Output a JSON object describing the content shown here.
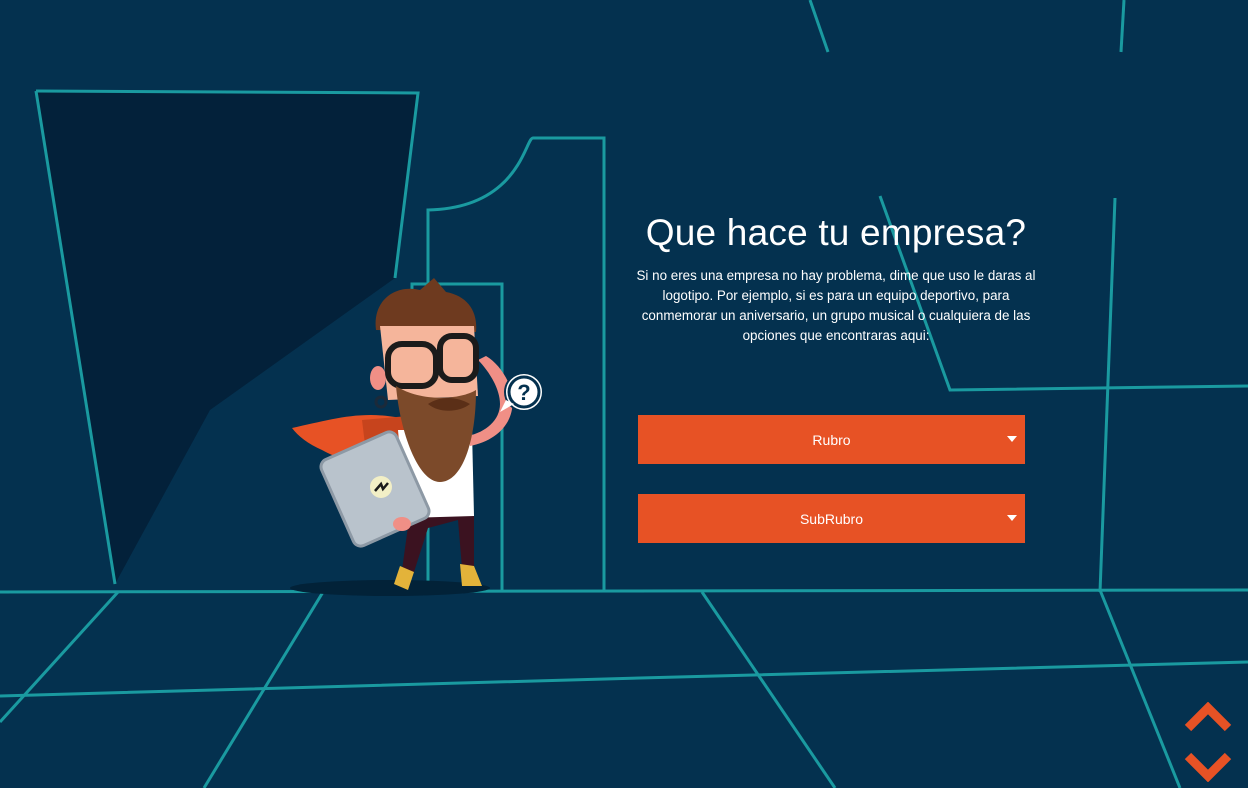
{
  "intro": {
    "title": "Que hace tu empresa?",
    "description": "Si no eres una empresa no hay problema, dime que uso le daras al logotipo. Por ejemplo, si es para un equipo deportivo, para conmemorar un aniversario, un grupo musical o cualquiera de las opciones que encontraras aqui:"
  },
  "selects": {
    "rubro_label": "Rubro",
    "subrubro_label": "SubRubro"
  },
  "navigation": {
    "up_icon": "chevron-up-icon",
    "down_icon": "chevron-down-icon"
  },
  "character": {
    "speech_bubble_symbol": "?"
  },
  "colors": {
    "background": "#04314f",
    "accent": "#e75225",
    "line": "#1a9aa0",
    "text": "#ffffff"
  }
}
